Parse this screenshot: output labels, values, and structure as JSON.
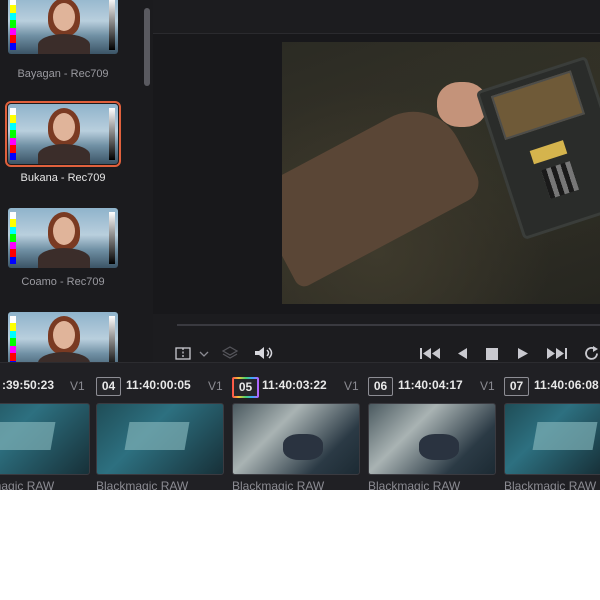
{
  "lut_browser": {
    "items": [
      {
        "label": "Bayagan - Rec709",
        "selected": false
      },
      {
        "label": "Bukana - Rec709",
        "selected": true
      },
      {
        "label": "Coamo - Rec709",
        "selected": false
      },
      {
        "label": "",
        "selected": false
      }
    ]
  },
  "transport": {
    "viewer_mode_icon": "viewer-layout-icon",
    "buttons": [
      "jump-to-start-icon",
      "step-back-icon",
      "stop-icon",
      "play-icon",
      "jump-to-end-icon",
      "loop-icon"
    ]
  },
  "timeline": {
    "clips": [
      {
        "number": "",
        "timecode": ":39:50:23",
        "track": "V1",
        "name": "Blackmagic RAW",
        "current": false
      },
      {
        "number": "04",
        "timecode": "11:40:00:05",
        "track": "V1",
        "name": "Blackmagic RAW",
        "current": false
      },
      {
        "number": "05",
        "timecode": "11:40:03:22",
        "track": "V1",
        "name": "Blackmagic RAW",
        "current": true
      },
      {
        "number": "06",
        "timecode": "11:40:04:17",
        "track": "V1",
        "name": "Blackmagic RAW",
        "current": false
      },
      {
        "number": "07",
        "timecode": "11:40:06:08",
        "track": "",
        "name": "Blackmagic RAW",
        "current": false
      }
    ]
  },
  "colors": {
    "selection": "#e0603c",
    "background": "#1e1e22"
  }
}
